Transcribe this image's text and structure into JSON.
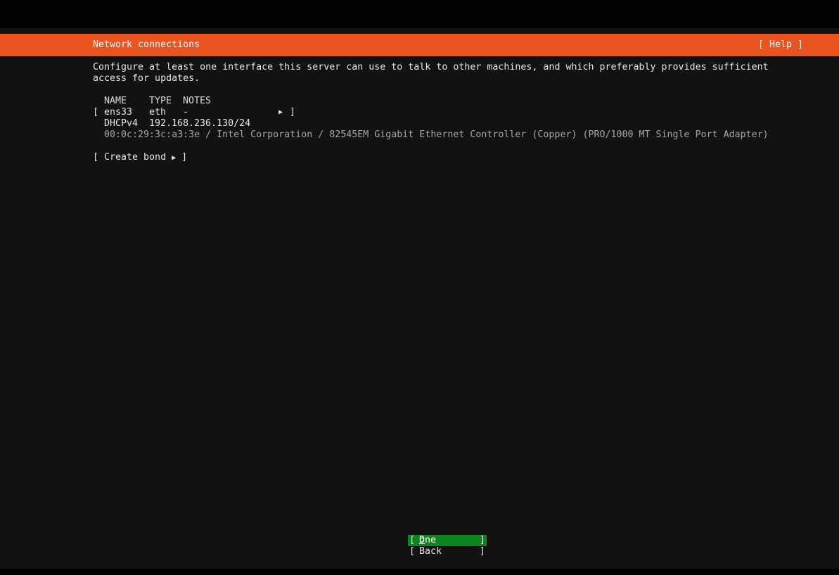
{
  "header": {
    "title": "Network connections",
    "help_label": "[ Help ]"
  },
  "description": {
    "line1": "Configure at least one interface this server can use to talk to other machines, and which preferably provides sufficient",
    "line2": "access for updates."
  },
  "table": {
    "columns": [
      "NAME",
      "TYPE",
      "NOTES"
    ],
    "interfaces": [
      {
        "open_bracket": "[",
        "name": "ens33",
        "type": "eth",
        "notes": "-",
        "arrow": "▶",
        "close_bracket": "]",
        "address_kind": "DHCPv4",
        "address": "192.168.236.130/24",
        "hardware": "00:0c:29:3c:a3:3e / Intel Corporation / 82545EM Gigabit Ethernet Controller (Copper) (PRO/1000 MT Single Port Adapter)"
      }
    ]
  },
  "create_bond": {
    "prefix": "[ Create bond ",
    "arrow": "▶",
    "suffix": " ]"
  },
  "buttons": {
    "done": {
      "open": "[",
      "label_first": "D",
      "label_rest": "one",
      "close": "]"
    },
    "back": {
      "open": "[",
      "label": "Back",
      "close": "]"
    }
  },
  "colors": {
    "header_bg": "#e95420",
    "done_bg": "#0e8420",
    "terminal_bg": "#121212"
  }
}
